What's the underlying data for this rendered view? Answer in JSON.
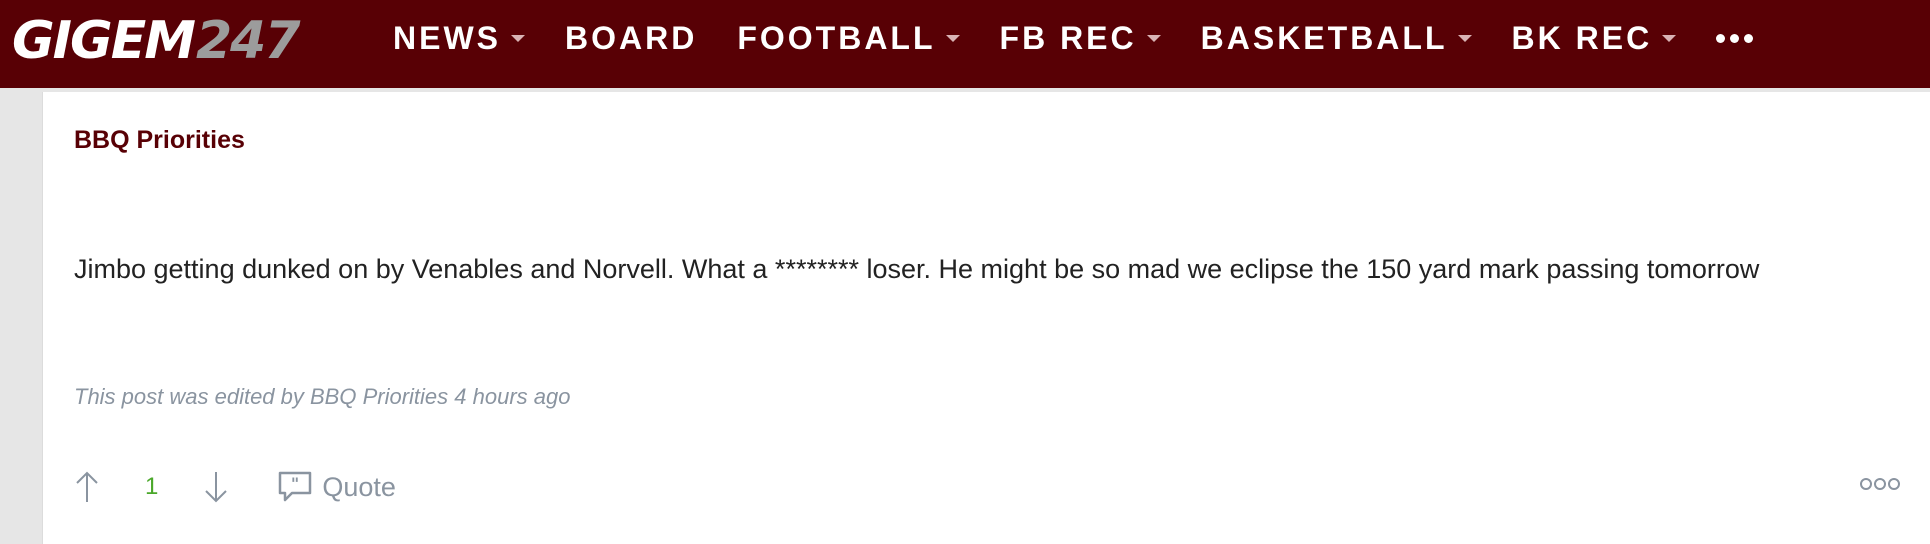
{
  "header": {
    "logo_brand": "GIGEM",
    "logo_number": "247",
    "nav": [
      {
        "label": "NEWS",
        "dropdown": true
      },
      {
        "label": "BOARD",
        "dropdown": false
      },
      {
        "label": "FOOTBALL",
        "dropdown": true
      },
      {
        "label": "FB REC",
        "dropdown": true
      },
      {
        "label": "BASKETBALL",
        "dropdown": true
      },
      {
        "label": "BK REC",
        "dropdown": true
      }
    ],
    "more_icon": "ellipsis-icon"
  },
  "post": {
    "author": "BBQ Priorities",
    "body": "Jimbo getting dunked on by Venables and Norvell. What a ******** loser. He might be so mad we eclipse the 150 yard mark passing tomorrow",
    "edit_note": "This post was edited by BBQ Priorities 4 hours ago",
    "vote_count": "1",
    "quote_label": "Quote"
  },
  "colors": {
    "brand": "#580005",
    "vote_count": "#4aa82a",
    "muted": "#8a94a0"
  }
}
